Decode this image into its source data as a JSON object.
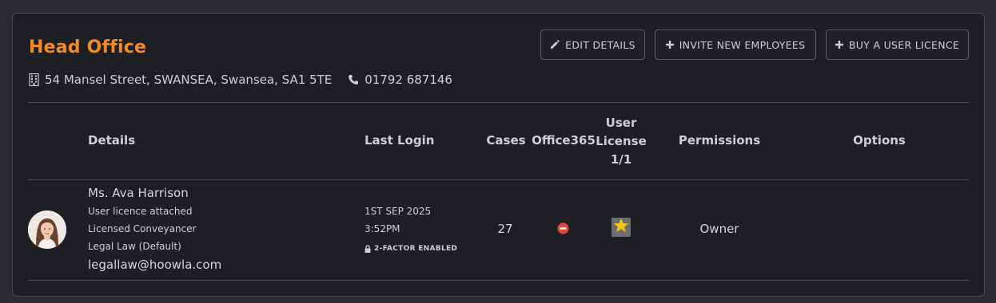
{
  "office": {
    "title": "Head Office",
    "address": "54 Mansel Street, SWANSEA, Swansea, SA1 5TE",
    "phone": "01792 687146"
  },
  "actions": {
    "edit": "EDIT DETAILS",
    "invite": "INVITE NEW EMPLOYEES",
    "buy": "BUY A USER LICENCE"
  },
  "table": {
    "headers": {
      "details": "Details",
      "last_login": "Last Login",
      "cases": "Cases",
      "office365": "Office365",
      "license_line1": "User",
      "license_line2": "License",
      "license_line3": "1/1",
      "permissions": "Permissions",
      "options": "Options"
    },
    "rows": [
      {
        "name": "Ms. Ava Harrison",
        "line1": "User licence attached",
        "line2": "Licensed Conveyancer",
        "line3": "Legal Law (Default)",
        "email": "legallaw@hoowla.com",
        "login_date": "1ST SEP 2025",
        "login_time": "3:52PM",
        "twofa": "2-FACTOR ENABLED",
        "cases": "27",
        "office365_status": "disabled",
        "license_status": "star",
        "permission": "Owner"
      }
    ]
  },
  "colors": {
    "accent": "#f08a2c",
    "disabled": "#e0483c",
    "star": "#f5c518"
  }
}
